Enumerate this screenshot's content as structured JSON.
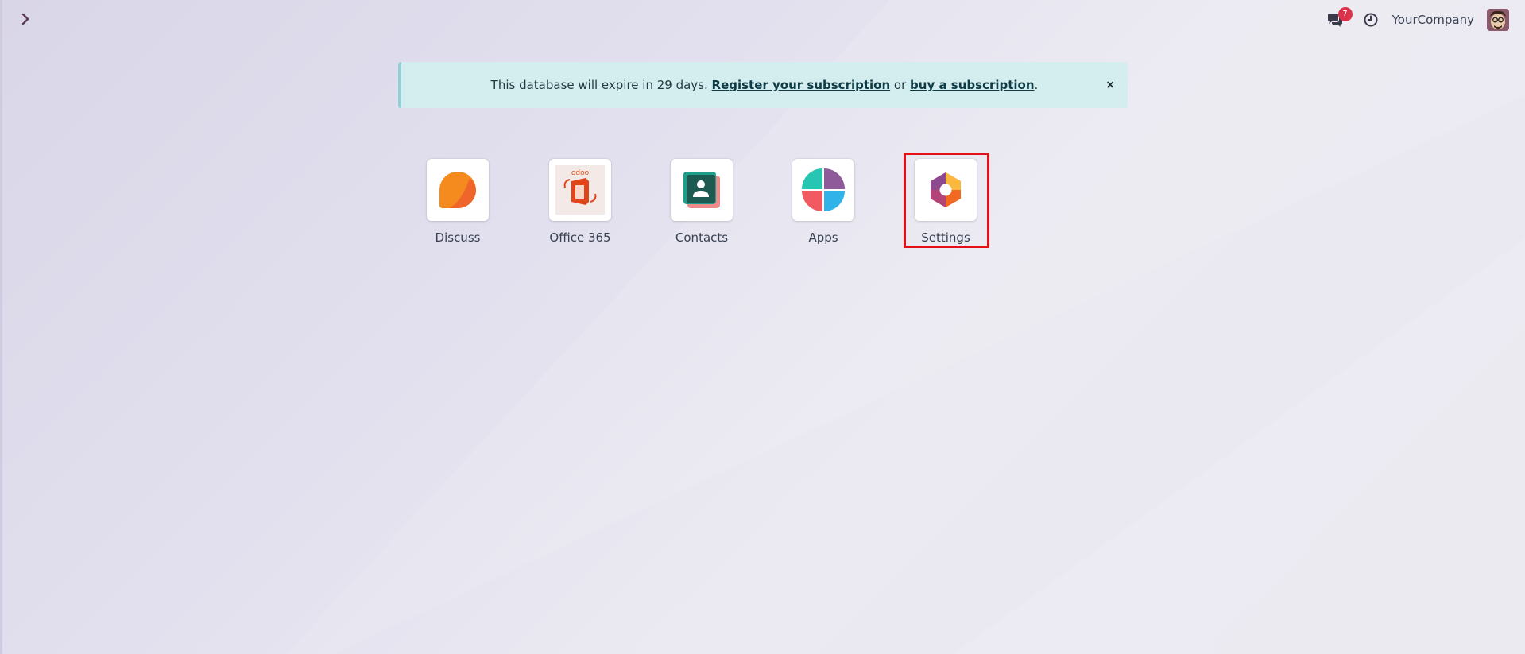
{
  "topbar": {
    "messages_badge": "7",
    "company_name": "YourCompany"
  },
  "banner": {
    "text_before": "This database will expire in 29 days. ",
    "register_link": "Register your subscription",
    "text_middle": " or ",
    "buy_link": "buy a subscription",
    "text_after": ".",
    "close_label": "×"
  },
  "apps": [
    {
      "label": "Discuss",
      "icon": "discuss-icon"
    },
    {
      "label": "Office 365",
      "icon": "office365-icon"
    },
    {
      "label": "Contacts",
      "icon": "contacts-icon"
    },
    {
      "label": "Apps",
      "icon": "apps-icon"
    },
    {
      "label": "Settings",
      "icon": "settings-icon"
    }
  ],
  "colors": {
    "banner_bg": "#d4eef0",
    "badge": "#d9324a",
    "highlight": "#e3101a"
  }
}
